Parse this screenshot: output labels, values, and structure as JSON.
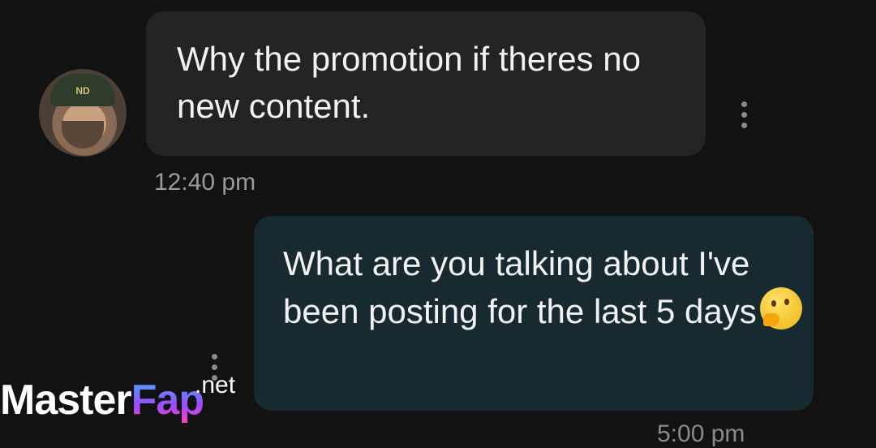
{
  "messages": [
    {
      "direction": "incoming",
      "text": "Why the promotion if theres no new content.",
      "time": "12:40 pm"
    },
    {
      "direction": "outgoing",
      "text": "What are you talking about I've been posting for the last 5 days",
      "emoji": "thinking-face",
      "time": "5:00 pm"
    }
  ],
  "watermark": {
    "part1": "Master",
    "part2": "Fap",
    "suffix": ".net"
  },
  "colors": {
    "background": "#121212",
    "incoming_bubble": "#232323",
    "outgoing_bubble": "#162a30",
    "text": "#f2f2f2",
    "timestamp": "#9a9a9a"
  }
}
